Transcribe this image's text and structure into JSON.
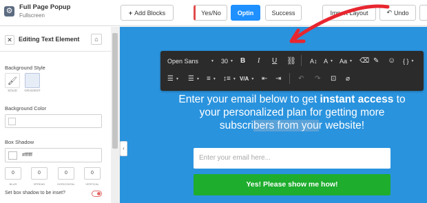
{
  "app": {
    "title": "Full Page Popup",
    "subtitle": "Fullscreen",
    "icon": "gear-icon"
  },
  "topbar": {
    "add_blocks": "Add Blocks",
    "yes_no": "Yes/No",
    "optin": "Optin",
    "success": "Success",
    "import_layout": "Import Layout",
    "undo": "Undo"
  },
  "panel": {
    "title": "Editing Text Element",
    "background_style": "Background Style",
    "style_solid": "SOLID",
    "style_gradient": "GRADIENT",
    "background_color": "Background Color",
    "box_shadow": "Box Shadow",
    "shadow_color": "#ffffff",
    "blur": "0",
    "spread": "0",
    "horizontal": "0",
    "vertical": "0",
    "blur_label": "BLUR",
    "spread_label": "SPREAD",
    "horizontal_label": "HORIZONTAL",
    "vertical_label": "VERTICAL",
    "inset_label": "Set box shadow to be inset?"
  },
  "toolbar": {
    "font": "Open Sans",
    "size": "30",
    "bold": "B",
    "italic": "I",
    "underline": "U",
    "font_size_icon": "A↕",
    "text_color": "A",
    "case": "Aa",
    "valign": "V/A"
  },
  "canvas": {
    "headline_part1": "Enter your email below to get ",
    "headline_bold": "instant access",
    "headline_part2": " to",
    "headline_line2": "your personalized plan for getting more",
    "headline_line3_a": "subscri",
    "headline_line3_highlight": "bers from you",
    "headline_line3_b": "r website!",
    "email_placeholder": "Enter your email here...",
    "cta_label": "Yes! Please show me how!"
  },
  "colors": {
    "canvas_bg": "#2a93de",
    "cta_bg": "#1fad2e",
    "optin_active": "#1e90ff",
    "arrow": "#e8262f",
    "toolbar_bg": "#2b2b2b"
  }
}
